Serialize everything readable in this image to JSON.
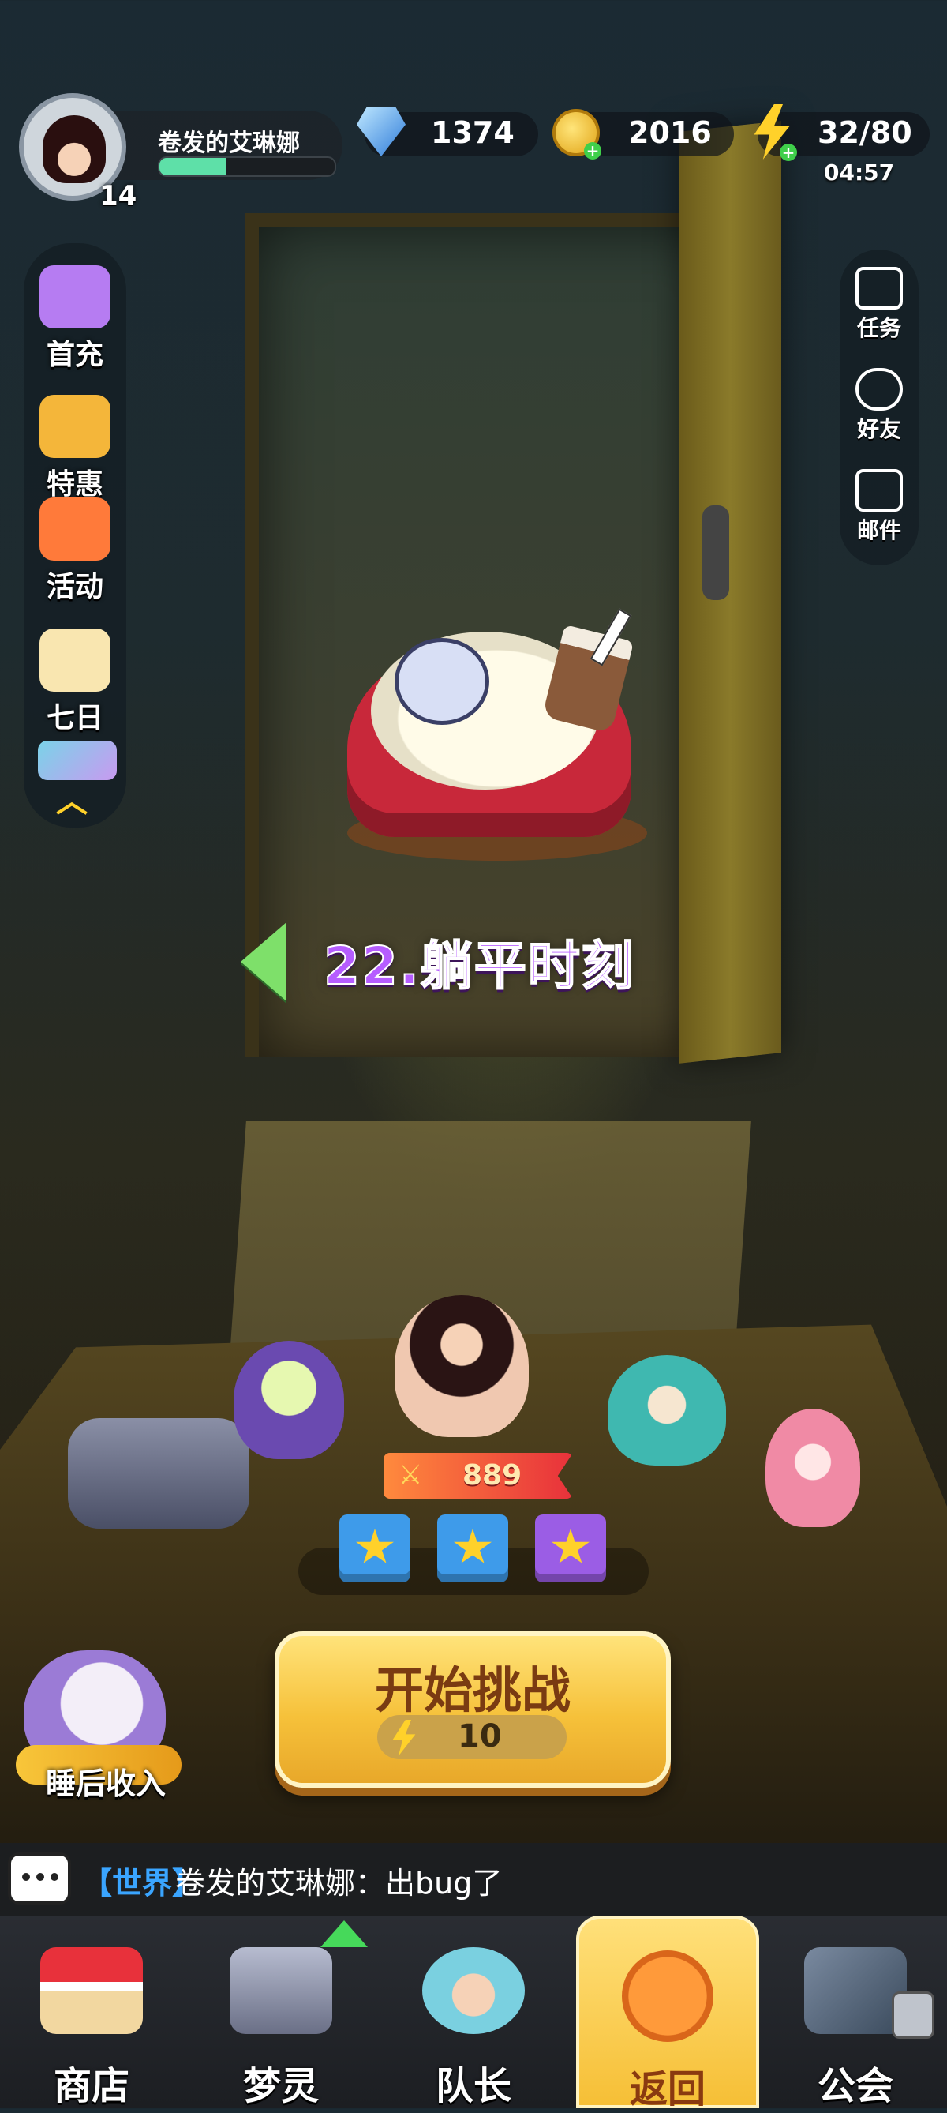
{
  "player": {
    "name": "卷发的艾琳娜",
    "level": "14",
    "xp_fraction": 0.38
  },
  "resources": {
    "gems": "1374",
    "coins": "2016",
    "energy": "32/80",
    "energy_timer": "04:57"
  },
  "left_menu": [
    {
      "label": "首充",
      "icon": "hammer-icon",
      "color": "#b67cf2"
    },
    {
      "label": "特惠",
      "icon": "coupon-icon",
      "color": "#f4b63a"
    },
    {
      "label": "活动",
      "icon": "gift-box-icon",
      "color": "#ff7a3a"
    },
    {
      "label": "七日",
      "icon": "calendar-icon",
      "color": "#f9e6b0"
    }
  ],
  "right_menu": [
    {
      "label": "任务",
      "icon": "task-icon"
    },
    {
      "label": "好友",
      "icon": "friends-icon"
    },
    {
      "label": "邮件",
      "icon": "mail-icon"
    }
  ],
  "stage": {
    "title": "22.躺平时刻"
  },
  "team": {
    "power": "889"
  },
  "rewards": [
    {
      "icon": "blue-star-chest-icon",
      "color": "#3e9bea"
    },
    {
      "icon": "blue-star-chest-icon",
      "color": "#3e9bea"
    },
    {
      "icon": "purple-star-chest-icon",
      "color": "#9b5de5"
    }
  ],
  "start": {
    "label": "开始挑战",
    "cost": "10"
  },
  "sleep_income": {
    "label": "睡后收入"
  },
  "chat": {
    "channel": "【世界】",
    "message": "卷发的艾琳娜：出bug了"
  },
  "bottom_nav": [
    {
      "label": "商店",
      "icon": "shop-icon",
      "active": false
    },
    {
      "label": "梦灵",
      "icon": "robot-icon",
      "active": false,
      "badge": "upgrade-arrow"
    },
    {
      "label": "队长",
      "icon": "captain-icon",
      "active": false
    },
    {
      "label": "返回",
      "icon": "return-icon",
      "active": true
    },
    {
      "label": "公会",
      "icon": "guild-icon",
      "active": false,
      "locked": true
    }
  ]
}
